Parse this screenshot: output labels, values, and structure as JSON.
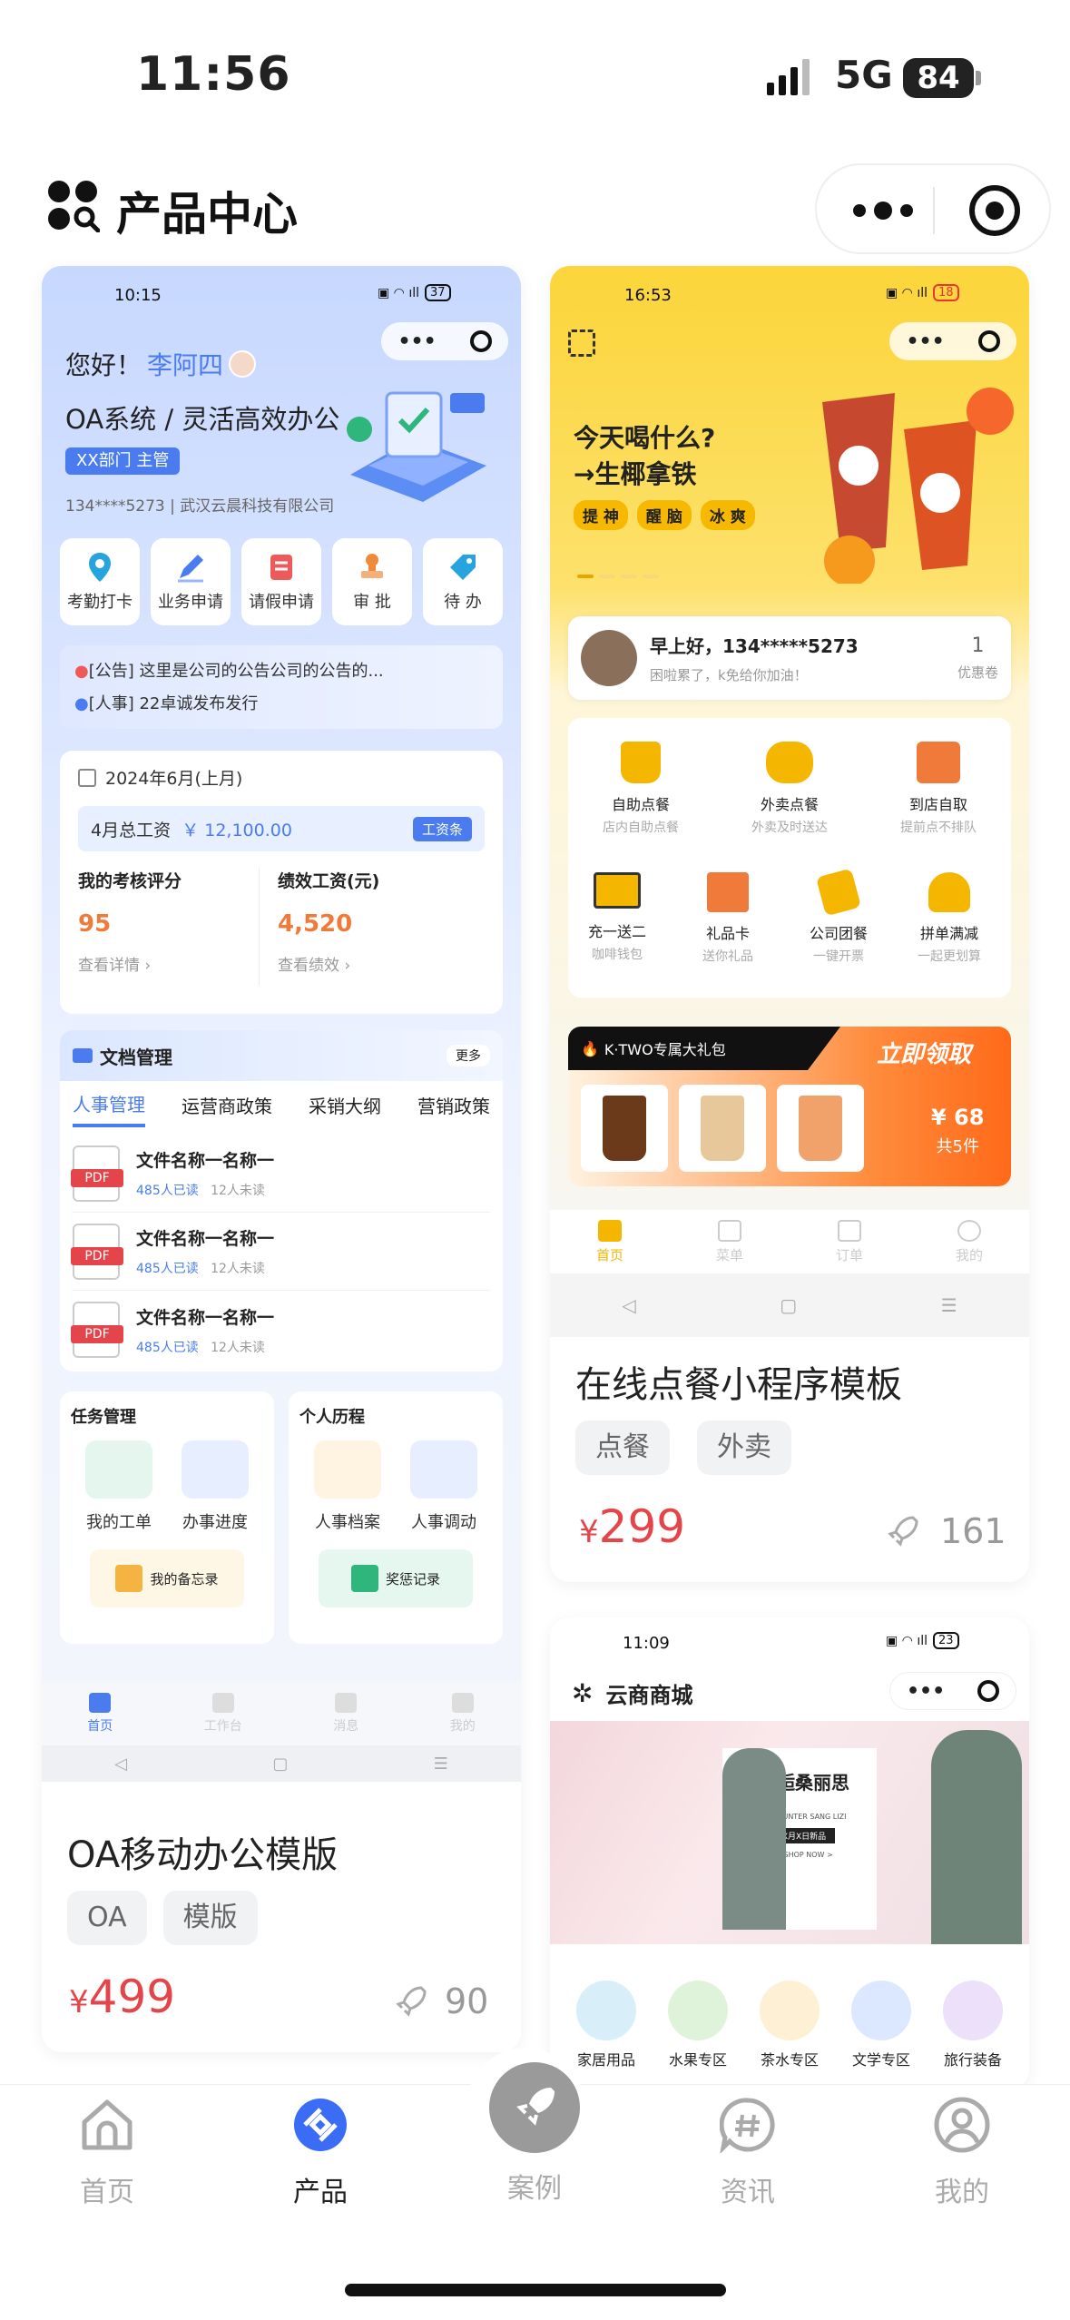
{
  "status_bar": {
    "time": "11:56",
    "network": "5G",
    "battery": "84"
  },
  "header": {
    "title": "产品中心"
  },
  "oa_card": {
    "mini_time": "10:15",
    "mini_battery": "37",
    "greeting": "您好！",
    "user_name": "李阿四",
    "headline": "OA系统 / 灵活高效办公",
    "dept_badge": "XX部门 主管",
    "phone_company": "134****5273 | 武汉云晨科技有限公司",
    "quick_actions": [
      {
        "label": "考勤打卡",
        "icon": "location-icon",
        "color": "#27a4dd"
      },
      {
        "label": "业务申请",
        "icon": "pen-icon",
        "color": "#4a7cf0"
      },
      {
        "label": "请假申请",
        "icon": "doc-icon",
        "color": "#ee5a5a"
      },
      {
        "label": "审 批",
        "icon": "stamp-icon",
        "color": "#f08a3a"
      },
      {
        "label": "待 办",
        "icon": "tag-icon",
        "color": "#27a4dd"
      }
    ],
    "notices": [
      "[公告] 这里是公司的公告公司的公告的...",
      "[人事] 22卓诚发布发行"
    ],
    "salary": {
      "period": "2024年6月(上月)",
      "total_label": "4月总工资",
      "total_value": "￥ 12,100.00",
      "slip_button": "工资条",
      "score_label": "我的考核评分",
      "score_value": "95",
      "score_link": "查看详情",
      "perf_label": "绩效工资(元)",
      "perf_value": "4,520",
      "perf_link": "查看绩效"
    },
    "docs": {
      "title": "文档管理",
      "more": "更多",
      "tabs": [
        "人事管理",
        "运营商政策",
        "采销大纲",
        "营销政策"
      ],
      "pdf_label": "PDF",
      "items": [
        {
          "name": "文件名称一名称一",
          "read": "485人已读",
          "unread": "12人未读"
        },
        {
          "name": "文件名称一名称一",
          "read": "485人已读",
          "unread": "12人未读"
        },
        {
          "name": "文件名称一名称一",
          "read": "485人已读",
          "unread": "12人未读"
        }
      ]
    },
    "tasks": {
      "title": "任务管理",
      "items": [
        "我的工单",
        "办事进度"
      ],
      "memo": "我的备忘录"
    },
    "history": {
      "title": "个人历程",
      "items": [
        "人事档案",
        "人事调动"
      ],
      "record": "奖惩记录"
    },
    "mini_tabs": [
      "首页",
      "工作台",
      "消息",
      "我的"
    ],
    "product_name": "OA移动办公模版",
    "tags": [
      "OA",
      "模版"
    ],
    "price_symbol": "¥",
    "price": "499",
    "launches": "90"
  },
  "food_card": {
    "mini_time": "16:53",
    "mini_battery": "18",
    "slogan_1": "今天喝什么?",
    "slogan_2": "→生椰拿铁",
    "chips": [
      "提 神",
      "醒 脑",
      "冰 爽"
    ],
    "user_greeting": "早上好，134*****5273",
    "user_sub": "困啦累了，k免给你加油！",
    "coupon_count": "1",
    "coupon_label": "优惠卷",
    "services": [
      {
        "label": "自助点餐",
        "sub": "店内自助点餐"
      },
      {
        "label": "外卖点餐",
        "sub": "外卖及时送达"
      },
      {
        "label": "到店自取",
        "sub": "提前点不排队"
      },
      {
        "label": "充一送二",
        "sub": "咖啡钱包"
      },
      {
        "label": "礼品卡",
        "sub": "送你礼品"
      },
      {
        "label": "公司团餐",
        "sub": "一键开票"
      },
      {
        "label": "拼单满减",
        "sub": "一起更划算"
      }
    ],
    "promo_title": "K·TWO专属大礼包",
    "promo_cta": "立即领取",
    "promo_price": "¥ 68",
    "promo_count": "共5件",
    "mini_tabs": [
      "首页",
      "菜单",
      "订单",
      "我的"
    ],
    "product_name": "在线点餐小程序模板",
    "tags": [
      "点餐",
      "外卖"
    ],
    "price_symbol": "¥",
    "price": "299",
    "launches": "161"
  },
  "mall_card": {
    "mini_time": "11:09",
    "mini_battery": "23",
    "title": "云商商城",
    "banner_title": "邂逅桑丽思",
    "banner_sub": "ENCOUNTER SANG LIZI",
    "banner_date": "X月X日新品",
    "banner_shop": "< SHOP NOW >",
    "categories": [
      "家居用品",
      "水果专区",
      "茶水专区",
      "文学专区",
      "旅行装备"
    ]
  },
  "tabbar": {
    "tabs": [
      {
        "label": "首页",
        "active": false
      },
      {
        "label": "产品",
        "active": true
      },
      {
        "label": "案例",
        "active": false
      },
      {
        "label": "资讯",
        "active": false
      },
      {
        "label": "我的",
        "active": false
      }
    ],
    "accent": "#3b6cf6"
  }
}
